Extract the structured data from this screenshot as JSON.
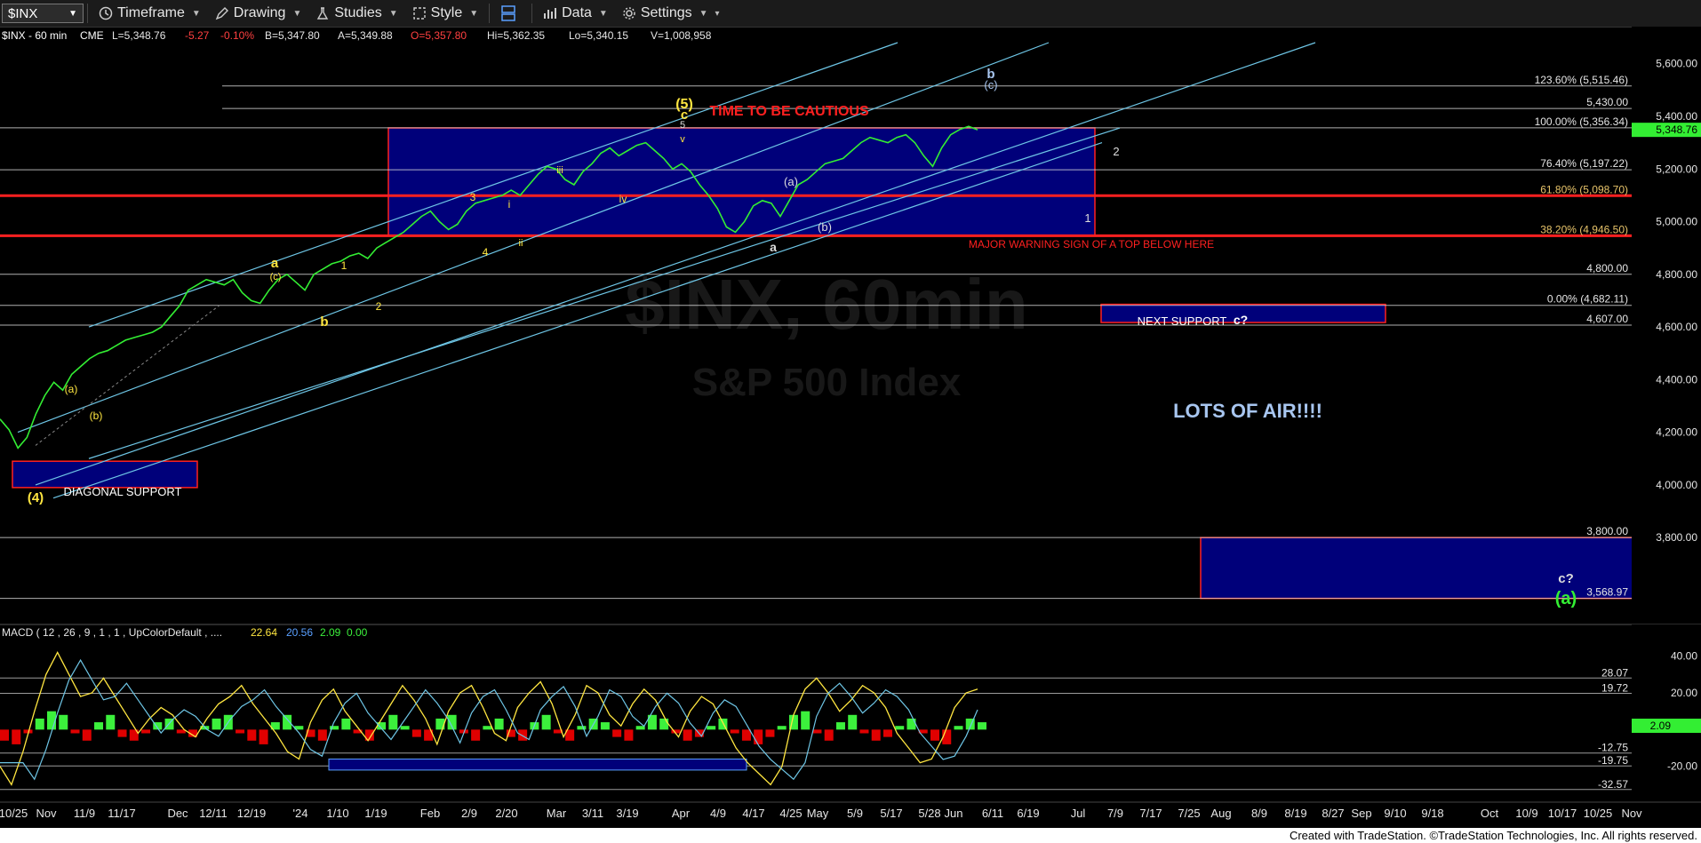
{
  "toolbar": {
    "symbol": "$INX",
    "timeframe": "Timeframe",
    "drawing": "Drawing",
    "studies": "Studies",
    "style": "Style",
    "data": "Data",
    "settings": "Settings"
  },
  "header": {
    "symbol": "$INX - 60 min",
    "exchange": "CME",
    "last": "L=5,348.76",
    "change": "-5.27",
    "change_pct": "-0.10%",
    "bid": "B=5,347.80",
    "ask": "A=5,349.88",
    "open": "O=5,357.80",
    "high": "Hi=5,362.35",
    "low": "Lo=5,340.15",
    "volume": "V=1,008,958"
  },
  "watermark": {
    "line1": "$INX, 60min",
    "line2": "S&P 500 Index"
  },
  "footer": "Created with TradeStation. ©TradeStation Technologies, Inc. All rights reserved.",
  "colors": {
    "price": "#33ee33",
    "channel": "#6ec6e6",
    "red": "#ff2020",
    "box": "#00007a",
    "yellow": "#ffe640",
    "macd_pos": "#3cf03c",
    "macd_neg": "#e00000"
  },
  "chart_data": [
    {
      "type": "line",
      "name": "price",
      "ylim": [
        3480,
        5680
      ],
      "y_ticks": [
        "5,600.00",
        "5,400.00",
        "5,200.00",
        "5,000.00",
        "4,800.00",
        "4,600.00",
        "4,400.00",
        "4,200.00",
        "4,000.00",
        "3,800.00"
      ],
      "y_tick_values": [
        5600,
        5400,
        5200,
        5000,
        4800,
        4600,
        4400,
        4200,
        4000,
        3800
      ],
      "x_categories": [
        "10/25",
        "Nov",
        "11/9",
        "11/17",
        "Dec",
        "12/11",
        "12/19",
        "'24",
        "1/10",
        "1/19",
        "Feb",
        "2/9",
        "2/20",
        "Mar",
        "3/11",
        "3/19",
        "Apr",
        "4/9",
        "4/17",
        "4/25",
        "May",
        "5/9",
        "5/17",
        "5/28",
        "Jun",
        "6/11",
        "6/19",
        "Jul",
        "7/9",
        "7/17",
        "7/25",
        "Aug",
        "8/9",
        "8/19",
        "8/27",
        "Sep",
        "9/10",
        "9/18",
        "Oct",
        "10/9",
        "10/17",
        "10/25",
        "Nov"
      ],
      "price_series": [
        4250,
        4210,
        4140,
        4180,
        4270,
        4340,
        4390,
        4360,
        4420,
        4450,
        4480,
        4500,
        4510,
        4530,
        4550,
        4560,
        4570,
        4580,
        4600,
        4640,
        4680,
        4740,
        4760,
        4780,
        4770,
        4760,
        4780,
        4730,
        4700,
        4690,
        4740,
        4780,
        4800,
        4770,
        4740,
        4800,
        4820,
        4840,
        4850,
        4870,
        4880,
        4860,
        4900,
        4920,
        4940,
        4960,
        4990,
        5020,
        5040,
        5000,
        4970,
        4990,
        5040,
        5070,
        5080,
        5090,
        5100,
        5120,
        5100,
        5140,
        5180,
        5210,
        5200,
        5160,
        5140,
        5190,
        5220,
        5260,
        5280,
        5250,
        5270,
        5290,
        5300,
        5270,
        5240,
        5200,
        5220,
        5190,
        5140,
        5100,
        5050,
        4980,
        4960,
        5000,
        5060,
        5080,
        5070,
        5020,
        5080,
        5140,
        5160,
        5190,
        5220,
        5230,
        5240,
        5270,
        5300,
        5320,
        5310,
        5300,
        5320,
        5330,
        5300,
        5250,
        5210,
        5280,
        5330,
        5350,
        5362,
        5349
      ],
      "levels": [
        {
          "value": 5515.46,
          "label": "123.60% (5,515.46)",
          "color": "#dddddd"
        },
        {
          "value": 5430,
          "label": "5,430.00",
          "color": "#dddddd"
        },
        {
          "value": 5356.34,
          "label": "100.00% (5,356.34)",
          "color": "#dddddd"
        },
        {
          "value": 5197.22,
          "label": "76.40% (5,197.22)",
          "color": "#dddddd"
        },
        {
          "value": 5098.7,
          "label": "61.80% (5,098.70)",
          "color": "#ff2020"
        },
        {
          "value": 4946.5,
          "label": "38.20% (4,946.50)",
          "color": "#ff2020"
        },
        {
          "value": 4800,
          "label": "4,800.00",
          "color": "#dddddd"
        },
        {
          "value": 4682.11,
          "label": "0.00% (4,682.11)",
          "color": "#dddddd"
        },
        {
          "value": 4607,
          "label": "4,607.00",
          "color": "#dddddd"
        },
        {
          "value": 3800,
          "label": "3,800.00",
          "color": "#dddddd"
        },
        {
          "value": 3568.97,
          "label": "3,568.97",
          "color": "#dddddd"
        }
      ],
      "last_price_label": "5,348.76",
      "annotations": {
        "time_to_be_cautious": "TIME TO BE CAUTIOUS",
        "major_warning": "MAJOR WARNING SIGN OF A TOP BELOW HERE",
        "next_support": "NEXT SUPPORT",
        "c_q": "c?",
        "lots_of_air": "LOTS OF AIR!!!!",
        "diagonal_support": "DIAGONAL SUPPORT",
        "wave_5": "(5)",
        "wave_c": "c",
        "wave_4": "(4)",
        "wave_a_paren": "(a)",
        "wave_b_paren": "(b)",
        "wave_c_paren": "(c)",
        "wave_a": "a",
        "wave_b": "b",
        "wave_1": "1",
        "wave_2": "2",
        "wave_3": "3",
        "wave_4s": "4",
        "wave_5s": "5",
        "wave_i": "i",
        "wave_ii": "ii",
        "wave_iii": "iii",
        "wave_iv": "iv",
        "wave_v": "v",
        "big_a": "(a)",
        "big_c_q": "c?"
      }
    },
    {
      "type": "bar",
      "name": "macd",
      "title": "MACD ( 12 , 26 , 9 , 1 , 1 , UpColorDefault , ....",
      "legend_values": [
        "22.64",
        "20.56",
        "2.09",
        "0.00"
      ],
      "ylim": [
        -38,
        48
      ],
      "y_ticks": [
        "40.00",
        "20.00",
        "-20.00"
      ],
      "y_tick_values": [
        40,
        20,
        -20
      ],
      "levels": [
        {
          "value": 28.07,
          "label": "28.07"
        },
        {
          "value": 19.72,
          "label": "19.72"
        },
        {
          "value": -12.75,
          "label": "-12.75"
        },
        {
          "value": -19.75,
          "label": "-19.75"
        },
        {
          "value": -32.57,
          "label": "-32.57"
        }
      ],
      "last_value_label": "2.09",
      "macd_series": [
        -20,
        -30,
        -12,
        10,
        30,
        42,
        30,
        18,
        20,
        28,
        18,
        8,
        -2,
        6,
        12,
        8,
        0,
        -4,
        6,
        14,
        18,
        24,
        14,
        6,
        -2,
        -12,
        -16,
        4,
        16,
        22,
        10,
        2,
        -6,
        4,
        14,
        24,
        16,
        6,
        -8,
        10,
        20,
        24,
        12,
        -2,
        -6,
        12,
        20,
        26,
        14,
        -4,
        8,
        24,
        20,
        8,
        2,
        14,
        22,
        16,
        4,
        -4,
        10,
        18,
        14,
        2,
        -10,
        -18,
        -24,
        -30,
        -20,
        8,
        22,
        28,
        20,
        10,
        16,
        24,
        20,
        12,
        -2,
        -10,
        -18,
        -16,
        -4,
        12,
        20,
        22
      ],
      "histogram": [
        -6,
        -8,
        -2,
        6,
        10,
        8,
        -2,
        -6,
        4,
        8,
        -4,
        -6,
        -2,
        4,
        6,
        -2,
        -4,
        2,
        6,
        8,
        -2,
        -6,
        -8,
        4,
        8,
        2,
        -4,
        -6,
        2,
        6,
        -2,
        -6,
        4,
        8,
        2,
        -4,
        -6,
        6,
        8,
        -2,
        -6,
        2,
        6,
        -4,
        -6,
        4,
        8,
        -2,
        -6,
        2,
        6,
        4,
        -4,
        -6,
        2,
        8,
        6,
        -2,
        -6,
        -4,
        2,
        6,
        -2,
        -6,
        -8,
        -4,
        2,
        8,
        10,
        -2,
        -6,
        4,
        8,
        -2,
        -6,
        -4,
        2,
        6,
        -2,
        -6,
        -8,
        2,
        6,
        4
      ],
      "annotations": {
        "bottom_box": ""
      }
    }
  ]
}
